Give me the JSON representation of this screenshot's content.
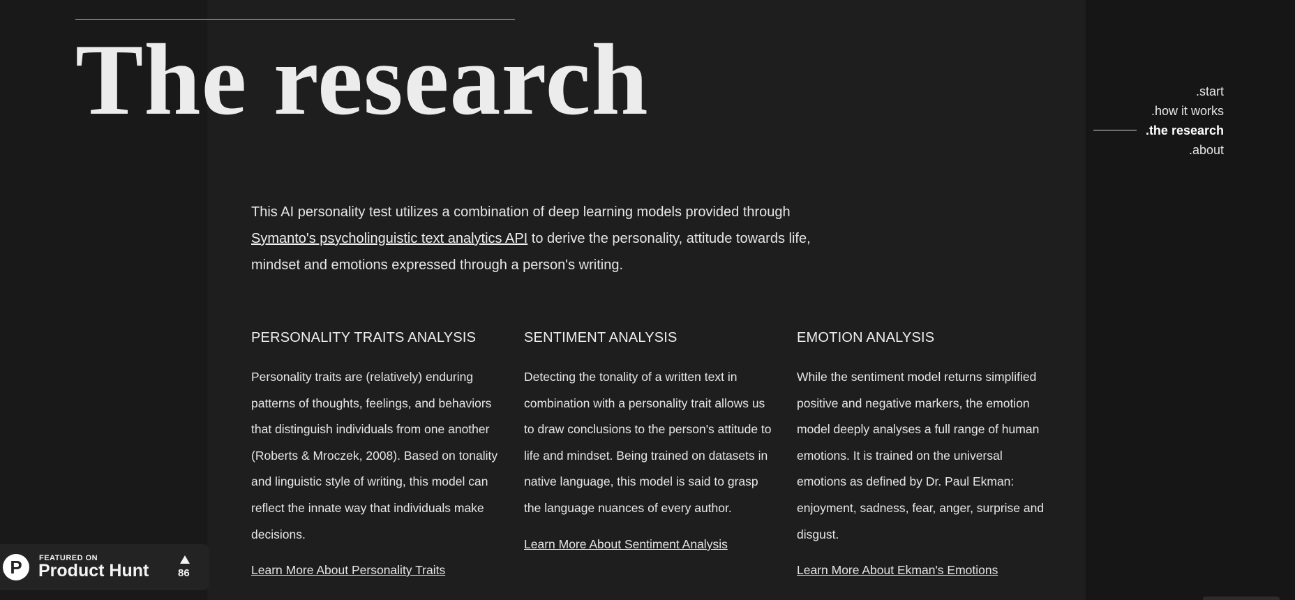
{
  "page": {
    "title": "The research"
  },
  "nav": {
    "items": [
      {
        "label": ".start"
      },
      {
        "label": ".how it works"
      },
      {
        "label": ".the research"
      },
      {
        "label": ".about"
      }
    ],
    "active": ".the research"
  },
  "intro": {
    "before_link": "This AI personality test utilizes a combination of deep learning models provided through ",
    "link_text": "Symanto's psycholinguistic text analytics API",
    "after_link": " to derive the personality, attitude towards life, mindset and emotions expressed through a person's writing."
  },
  "sections": [
    {
      "heading": "PERSONALITY TRAITS ANALYSIS",
      "body": "Personality traits are (relatively) enduring patterns of thoughts, feelings, and behaviors that distinguish individuals from one another (Roberts & Mroczek, 2008). Based on tonality and linguistic style of writing, this model can reflect the innate way that individuals make decisions.",
      "link": "Learn More About Personality Traits"
    },
    {
      "heading": "SENTIMENT ANALYSIS",
      "body": "Detecting the tonality of a written text in combination with a personality trait allows us to draw conclusions to the person's attitude to life and mindset. Being trained on datasets in native language, this model is said to grasp the language nuances of every author.",
      "link": "Learn More About Sentiment Analysis"
    },
    {
      "heading": "EMOTION ANALYSIS",
      "body": "While the sentiment model returns simplified positive and negative markers, the emotion model deeply analyses a full range of human emotions. It is trained on the universal emotions as defined by Dr. Paul Ekman: enjoyment, sadness, fear, anger, surprise and disgust.",
      "link": "Learn More About Ekman's Emotions"
    }
  ],
  "product_hunt": {
    "featured_label": "FEATURED ON",
    "name": "Product Hunt",
    "upvotes": "86",
    "logo_letter": "P",
    "icon": "product-hunt-logo-icon"
  },
  "colors": {
    "background": "#161616",
    "panel": "#1e1e1f",
    "text": "#e6e6e6"
  }
}
